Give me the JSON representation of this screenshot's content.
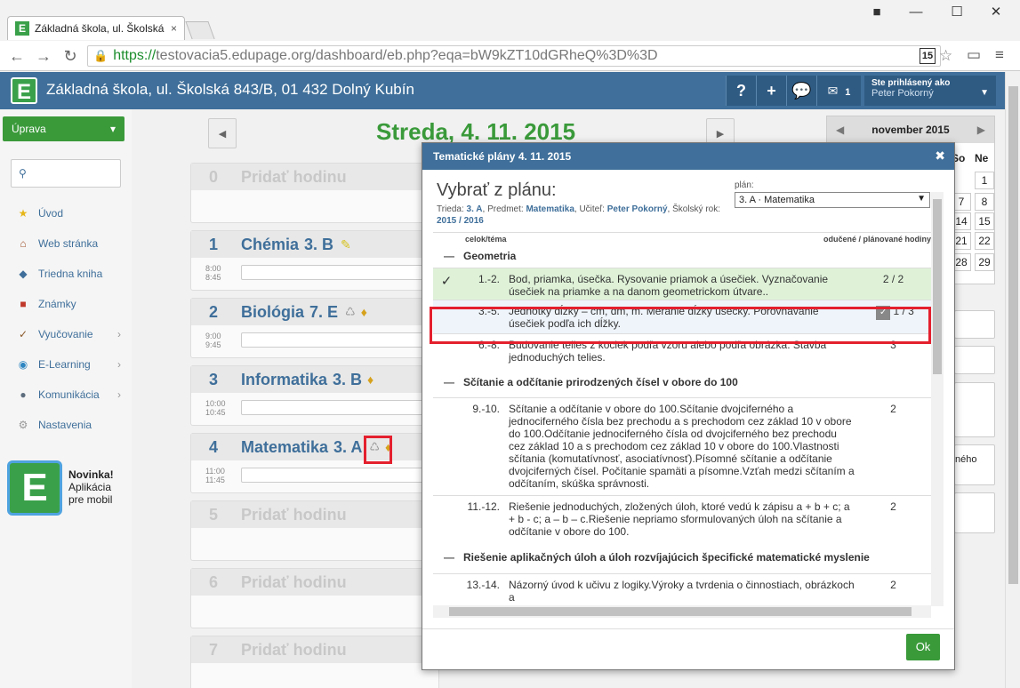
{
  "browser": {
    "tab_title": "Základná škola, ul. Školská",
    "tab_close": "×",
    "url_https": "https://",
    "url_rest": "testovacia5.edupage.org/dashboard/eb.php?eqa=bW9kZT10dGRheQ%3D%3D",
    "badge": "15"
  },
  "header": {
    "school": "Základná škola, ul. Školská 843/B, 01 432 Dolný Kubín",
    "help": "?",
    "add": "+",
    "msg_count": "1",
    "user_label": "Ste prihlásený ako",
    "user_name": "Peter Pokorný"
  },
  "sidebar": {
    "edit": "Úprava",
    "items": [
      {
        "label": "Úvod"
      },
      {
        "label": "Web stránka"
      },
      {
        "label": "Triedna kniha"
      },
      {
        "label": "Známky"
      },
      {
        "label": "Vyučovanie"
      },
      {
        "label": "E-Learning"
      },
      {
        "label": "Komunikácia"
      },
      {
        "label": "Nastavenia"
      }
    ],
    "promo_title": "Novinka!",
    "promo_l1": "Aplikácia",
    "promo_l2": "pre mobil"
  },
  "main": {
    "date": "Streda, 4. 11. 2015",
    "lessons": [
      {
        "num": "0",
        "subj": "Pridať hodinu"
      },
      {
        "num": "1",
        "subj": "Chémia",
        "cls": "3. B",
        "t1": "8:00",
        "t2": "8:45"
      },
      {
        "num": "2",
        "subj": "Biológia",
        "cls": "7. E",
        "t1": "9:00",
        "t2": "9:45"
      },
      {
        "num": "3",
        "subj": "Informatika",
        "cls": "3. B",
        "t1": "10:00",
        "t2": "10:45"
      },
      {
        "num": "4",
        "subj": "Matematika",
        "cls": "3. A",
        "t1": "11:00",
        "t2": "11:45"
      },
      {
        "num": "5",
        "subj": "Pridať hodinu"
      },
      {
        "num": "6",
        "subj": "Pridať hodinu"
      },
      {
        "num": "7",
        "subj": "Pridať hodinu"
      }
    ]
  },
  "calendar": {
    "month": "november 2015",
    "dow": [
      "So",
      "Ne"
    ],
    "rows": [
      [
        "",
        "1"
      ],
      [
        "7",
        "8"
      ],
      [
        "14",
        "15"
      ],
      [
        "21",
        "22"
      ],
      [
        "28",
        "29"
      ]
    ],
    "side_text": "ného"
  },
  "modal": {
    "title": "Tematické plány 4. 11. 2015",
    "heading": "Vybrať z plánu:",
    "info_trieda_l": "Trieda:",
    "info_trieda": "3. A",
    "info_pred_l": ", Predmet:",
    "info_pred": "Matematika",
    "info_uc_l": ", Učiteľ:",
    "info_uc": "Peter Pokorný",
    "info_rok_l": ", Školský rok:",
    "info_rok": "2015 / 2016",
    "plan_label": "plán:",
    "plan_value": "3. A · Matematika",
    "col_topic": "celok/téma",
    "col_hours": "odučené / plánované hodiny",
    "groups": [
      {
        "name": "Geometria",
        "rows": [
          {
            "num": "1.-2.",
            "text": "Bod, priamka, úsečka. Rysovanie priamok a úsečiek. Vyznačovanie úsečiek na priamke a na danom geometrickom útvare..",
            "hours": "2 / 2",
            "check": "✓"
          },
          {
            "num": "3.-5.",
            "text": "Jednotky dĺžky – cm, dm, m. Meranie dĺžky úsečky. Porovnávanie úsečiek podľa ich dĺžky.",
            "hours": "1 / 3",
            "check": ""
          },
          {
            "num": "6.-8.",
            "text": "Budovanie telies z kociek podľa vzoru alebo podľa obrázka. Stavba jednoduchých telies.",
            "hours": "3",
            "check": ""
          }
        ]
      },
      {
        "name": "Sčítanie a odčítanie prirodzených čísel v obore do 100",
        "rows": [
          {
            "num": "9.-10.",
            "text": "Sčítanie a odčítanie v obore do 100.Sčítanie dvojciferného a jednociferného čísla bez prechodu a s prechodom cez základ 10 v obore do 100.Odčítanie jednociferného čísla od dvojciferného bez prechodu cez základ 10 a s prechodom cez základ 10 v obore do 100.Vlastnosti sčítania (komutatívnosť, asociatívnosť).Písomné sčítanie a odčítanie dvojciferných čísel. Počítanie spamäti a písomne.Vzťah medzi sčítaním a odčítaním, skúška správnosti.",
            "hours": "2",
            "check": ""
          },
          {
            "num": "11.-12.",
            "text": "Riešenie jednoduchých, zložených úloh, ktoré vedú k zápisu a + b + c; a + b - c; a – b – c.Riešenie nepriamo sformulovaných úloh na sčítanie a odčítanie v obore do 100.",
            "hours": "2",
            "check": ""
          }
        ]
      },
      {
        "name": "Riešenie aplikačných úloh a úloh rozvíjajúcich špecifické matematické myslenie",
        "rows": [
          {
            "num": "13.-14.",
            "text": "Názorný úvod k učivu z logiky.Výroky a tvrdenia o činnostiach, obrázkoch a",
            "hours": "2",
            "check": ""
          }
        ]
      }
    ],
    "ok": "Ok"
  }
}
